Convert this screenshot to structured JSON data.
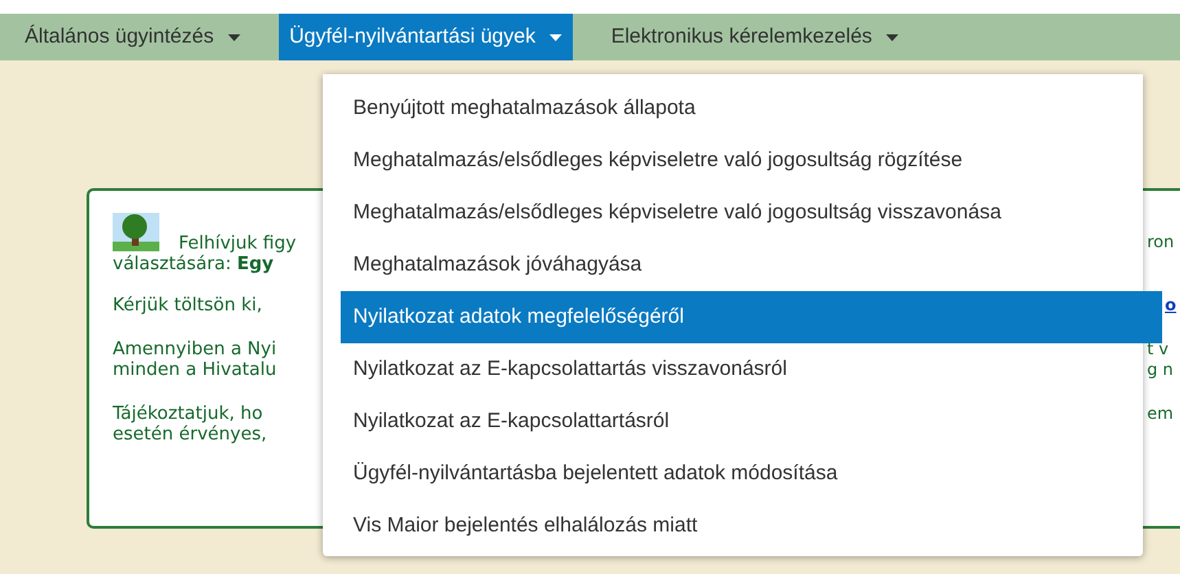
{
  "nav": {
    "tabs": [
      {
        "label": "Általános ügyintézés",
        "selected": false
      },
      {
        "label": "Ügyfél-nyilvántartási ügyek",
        "selected": true
      },
      {
        "label": "Elektronikus kérelemkezelés",
        "selected": false
      }
    ]
  },
  "dropdown": {
    "items": [
      {
        "label": "Benyújtott meghatalmazások állapota",
        "selected": false
      },
      {
        "label": "Meghatalmazás/elsődleges képviseletre való jogosultság rögzítése",
        "selected": false
      },
      {
        "label": "Meghatalmazás/elsődleges képviseletre való jogosultság visszavonása",
        "selected": false
      },
      {
        "label": "Meghatalmazások jóváhagyása",
        "selected": false
      },
      {
        "label": "Nyilatkozat adatok megfelelőségéről",
        "selected": true
      },
      {
        "label": "Nyilatkozat az E-kapcsolattartás visszavonásról",
        "selected": false
      },
      {
        "label": "Nyilatkozat az E-kapcsolattartásról",
        "selected": false
      },
      {
        "label": "Ügyfél-nyilvántartásba bejelentett adatok módosítása",
        "selected": false
      },
      {
        "label": "Vis Maior bejelentés elhalálozás miatt",
        "selected": false
      }
    ]
  },
  "panel": {
    "paragraphs": [
      {
        "lines": [
          "Felhívjuk figy",
          "választására: **Egy**"
        ],
        "right": [
          "ron"
        ],
        "icon": true
      },
      {
        "lines": [
          "Kérjük töltsön ki,"
        ],
        "right_link": "o"
      },
      {
        "lines": [
          "Amennyiben a Nyi",
          "minden a Hivatalu"
        ],
        "right": [
          "t v",
          "g n"
        ]
      },
      {
        "lines": [
          "Tájékoztatjuk, ho",
          "esetén érvényes,"
        ],
        "right": [
          "em"
        ]
      }
    ]
  }
}
